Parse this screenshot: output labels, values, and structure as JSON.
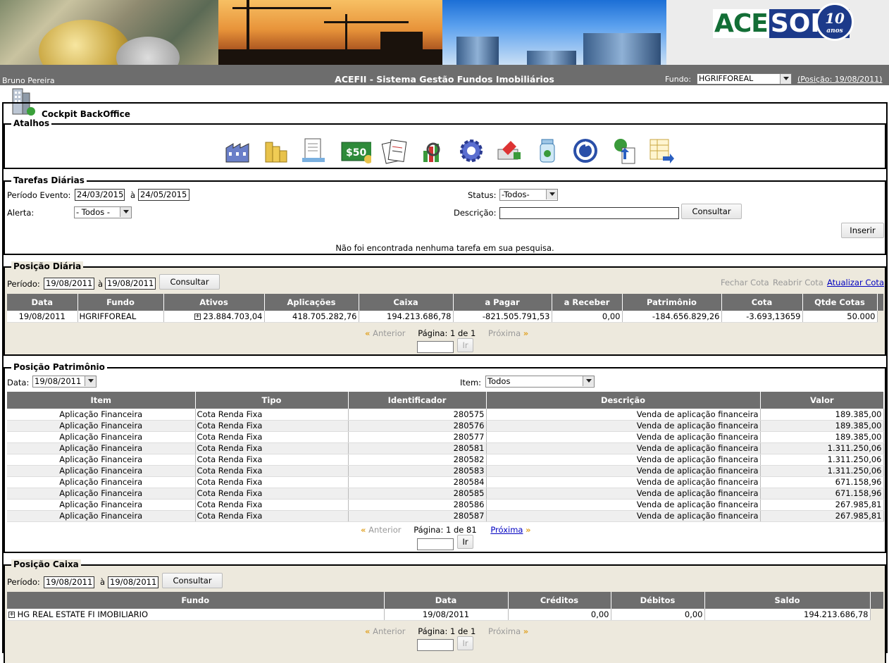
{
  "header": {
    "logo_acesoft_a": "ACE",
    "logo_acesoft_b": "SOFT",
    "logo_badge": "10",
    "logo_badge_sub": "anos",
    "user": "Bruno Pereira",
    "title": "ACEFII - Sistema Gestão Fundos Imobiliários",
    "fundo_label": "Fundo:",
    "fundo_value": "HGRIFFOREAL",
    "posicao_link": "(Posição: 19/08/2011)"
  },
  "cockpit": {
    "label": "Cockpit BackOffice"
  },
  "atalhos": {
    "legend": "Atalhos",
    "icons": [
      "building-icon",
      "coins-icon",
      "document-icon",
      "money-icon",
      "reports-icon",
      "chart-search-icon",
      "gear-icon",
      "tools-icon",
      "jar-icon",
      "refresh-icon",
      "upload-icon",
      "table-export-icon"
    ]
  },
  "tarefas": {
    "legend": "Tarefas Diárias",
    "periodo_label": "Período Evento:",
    "periodo_de": "24/03/2015",
    "periodo_sep": "à",
    "periodo_ate": "24/05/2015",
    "status_label": "Status:",
    "status_value": "-Todos-",
    "alerta_label": "Alerta:",
    "alerta_value": "- Todos -",
    "descricao_label": "Descrição:",
    "descricao_value": "",
    "consultar": "Consultar",
    "inserir": "Inserir",
    "empty_msg": "Não foi encontrada nenhuma tarefa em sua pesquisa."
  },
  "posicao_diaria": {
    "legend": "Posição Diária",
    "periodo_label": "Período:",
    "de": "19/08/2011",
    "sep": "à",
    "ate": "19/08/2011",
    "consultar": "Consultar",
    "fechar_cota": "Fechar Cota",
    "reabrir_cota": "Reabrir Cota",
    "atualizar_cota": "Atualizar Cota",
    "columns": [
      "Data",
      "Fundo",
      "Ativos",
      "Aplicações",
      "Caixa",
      "a Pagar",
      "a Receber",
      "Patrimônio",
      "Cota",
      "Qtde Cotas"
    ],
    "rows": [
      [
        "19/08/2011",
        "HGRIFFOREAL",
        "23.884.703,04",
        "418.705.282,76",
        "194.213.686,78",
        "-821.505.791,53",
        "0,00",
        "-184.656.829,26",
        "-3.693,13659",
        "50.000"
      ]
    ],
    "pager": {
      "anterior": "Anterior",
      "pagina": "Página: 1 de 1",
      "proxima": "Próxima",
      "ir": "Ir",
      "page_input": ""
    }
  },
  "posicao_patrimonio": {
    "legend": "Posição Patrimônio",
    "data_label": "Data:",
    "data_value": "19/08/2011",
    "item_label": "Item:",
    "item_value": "Todos",
    "columns": [
      "Item",
      "Tipo",
      "Identificador",
      "Descrição",
      "Valor"
    ],
    "rows": [
      [
        "Aplicação Financeira",
        "Cota Renda Fixa",
        "280575",
        "Venda de aplicação financeira",
        "189.385,00"
      ],
      [
        "Aplicação Financeira",
        "Cota Renda Fixa",
        "280576",
        "Venda de aplicação financeira",
        "189.385,00"
      ],
      [
        "Aplicação Financeira",
        "Cota Renda Fixa",
        "280577",
        "Venda de aplicação financeira",
        "189.385,00"
      ],
      [
        "Aplicação Financeira",
        "Cota Renda Fixa",
        "280581",
        "Venda de aplicação financeira",
        "1.311.250,06"
      ],
      [
        "Aplicação Financeira",
        "Cota Renda Fixa",
        "280582",
        "Venda de aplicação financeira",
        "1.311.250,06"
      ],
      [
        "Aplicação Financeira",
        "Cota Renda Fixa",
        "280583",
        "Venda de aplicação financeira",
        "1.311.250,06"
      ],
      [
        "Aplicação Financeira",
        "Cota Renda Fixa",
        "280584",
        "Venda de aplicação financeira",
        "671.158,96"
      ],
      [
        "Aplicação Financeira",
        "Cota Renda Fixa",
        "280585",
        "Venda de aplicação financeira",
        "671.158,96"
      ],
      [
        "Aplicação Financeira",
        "Cota Renda Fixa",
        "280586",
        "Venda de aplicação financeira",
        "267.985,81"
      ],
      [
        "Aplicação Financeira",
        "Cota Renda Fixa",
        "280587",
        "Venda de aplicação financeira",
        "267.985,81"
      ]
    ],
    "pager": {
      "anterior": "Anterior",
      "pagina": "Página: 1 de 81",
      "proxima": "Próxima",
      "ir": "Ir",
      "page_input": ""
    }
  },
  "posicao_caixa": {
    "legend": "Posição Caixa",
    "periodo_label": "Período:",
    "de": "19/08/2011",
    "sep": "à",
    "ate": "19/08/2011",
    "consultar": "Consultar",
    "columns": [
      "Fundo",
      "Data",
      "Créditos",
      "Débitos",
      "Saldo"
    ],
    "rows": [
      [
        "HG REAL ESTATE FI IMOBILIARIO",
        "19/08/2011",
        "0,00",
        "0,00",
        "194.213.686,78"
      ]
    ],
    "pager": {
      "anterior": "Anterior",
      "pagina": "Página: 1 de 1",
      "proxima": "Próxima",
      "ir": "Ir",
      "page_input": ""
    }
  },
  "colors": {
    "header_bar": "#6d6d6d",
    "beige": "#ede9dd",
    "link": "#0000c0",
    "chevron": "#e0a020"
  }
}
